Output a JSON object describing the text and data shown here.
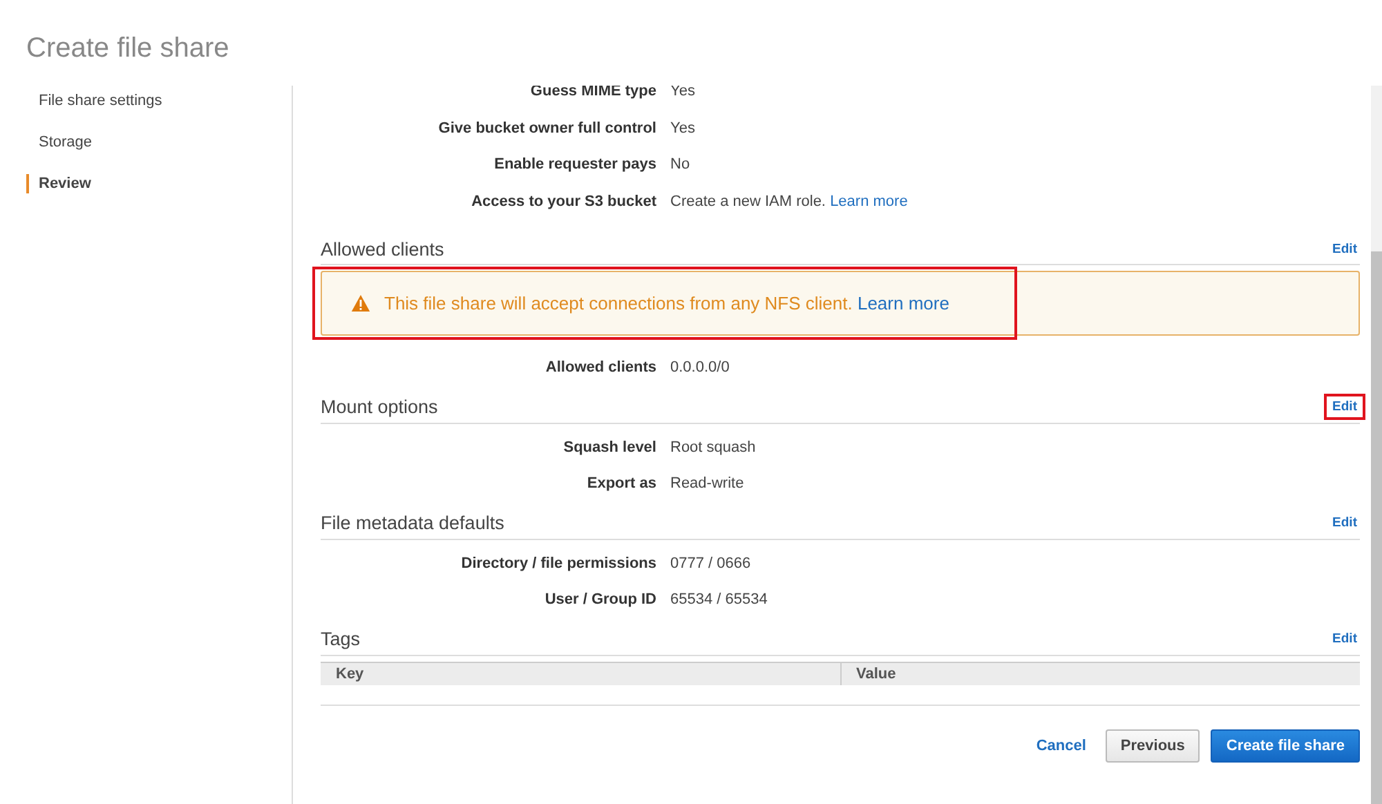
{
  "page": {
    "title": "Create file share"
  },
  "steps": [
    {
      "label": "File share settings",
      "selected": false
    },
    {
      "label": "Storage",
      "selected": false
    },
    {
      "label": "Review",
      "selected": true
    }
  ],
  "sections": [
    {
      "kind": "fields",
      "fields": [
        {
          "label": "Guess MIME type",
          "value": "Yes"
        },
        {
          "label": "Give bucket owner full control",
          "value": "Yes"
        },
        {
          "label": "Enable requester pays",
          "value": "No"
        },
        {
          "label": "Access to your S3 bucket",
          "value": "Create a new IAM role.",
          "link": "Learn more"
        }
      ]
    },
    {
      "kind": "section",
      "heading": "Allowed clients",
      "edit": "Edit",
      "edit_highlighted": false,
      "alert": {
        "text": "This file share will accept connections from any NFS client.",
        "link": "Learn more",
        "highlighted": true
      },
      "fields": [
        {
          "label": "Allowed clients",
          "value": "0.0.0.0/0"
        }
      ]
    },
    {
      "kind": "section",
      "heading": "Mount options",
      "edit": "Edit",
      "edit_highlighted": true,
      "fields": [
        {
          "label": "Squash level",
          "value": "Root squash"
        },
        {
          "label": "Export as",
          "value": "Read-write"
        }
      ]
    },
    {
      "kind": "section",
      "heading": "File metadata defaults",
      "edit": "Edit",
      "edit_highlighted": false,
      "fields": [
        {
          "label": "Directory / file permissions",
          "value": "0777 / 0666"
        },
        {
          "label": "User / Group ID",
          "value": "65534 / 65534"
        }
      ]
    },
    {
      "kind": "table",
      "heading": "Tags",
      "edit": "Edit",
      "edit_highlighted": false,
      "columns": [
        "Key",
        "Value"
      ]
    }
  ],
  "buttons": [
    {
      "label": "Cancel",
      "kind": "link"
    },
    {
      "label": "Previous",
      "kind": "secondary"
    },
    {
      "label": "Create file share",
      "kind": "primary"
    }
  ]
}
